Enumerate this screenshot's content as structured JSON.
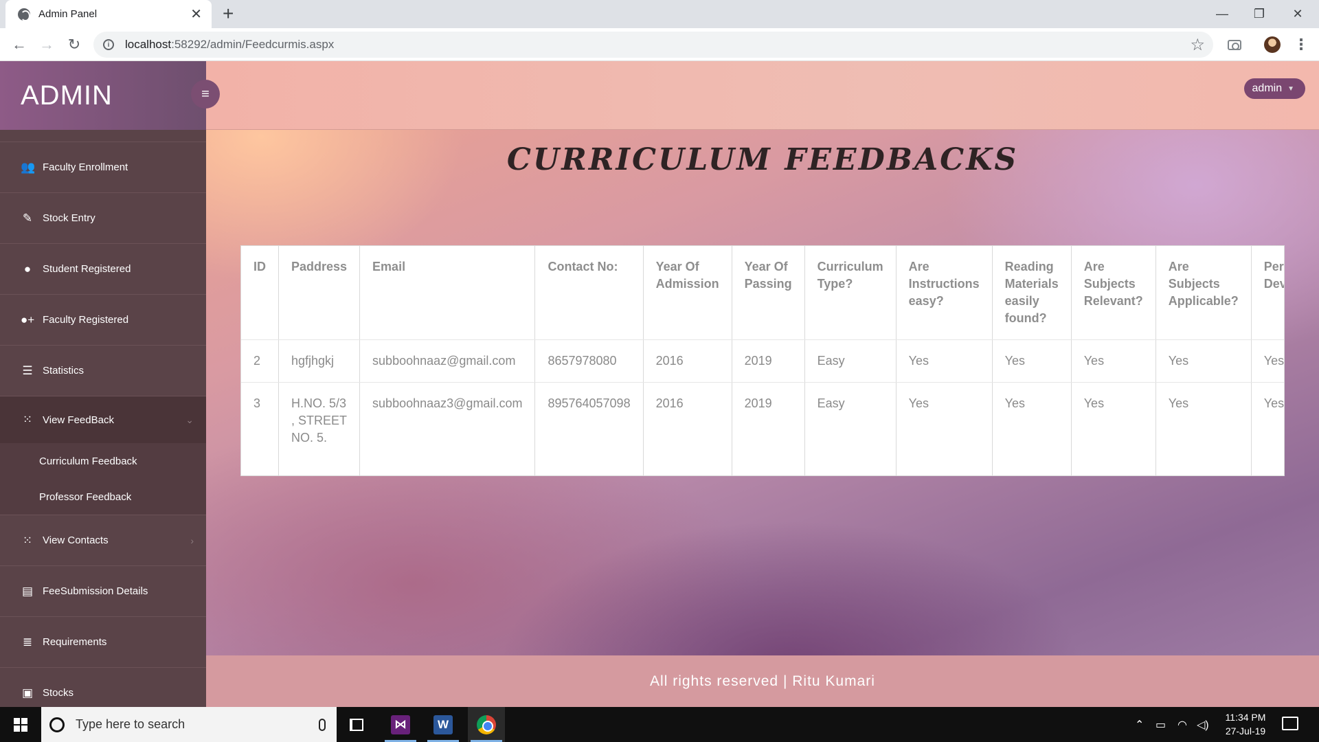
{
  "browser": {
    "tab_title": "Admin Panel",
    "tab_close": "✕",
    "new_tab": "+",
    "url_host": "localhost",
    "url_path": ":58292/admin/Feedcurmis.aspx",
    "window_controls": {
      "minimize": "—",
      "maximize": "❐",
      "close": "✕"
    }
  },
  "sidebar": {
    "brand": "ADMIN",
    "items": [
      {
        "label": "Faculty Enrollment",
        "icon": "users-icon"
      },
      {
        "label": "Stock Entry",
        "icon": "edit-icon"
      },
      {
        "label": "Student Registered",
        "icon": "user-icon"
      },
      {
        "label": "Faculty Registered",
        "icon": "user-plus-icon"
      },
      {
        "label": "Statistics",
        "icon": "list-icon"
      },
      {
        "label": "View FeedBack",
        "icon": "grid-icon",
        "expanded": true
      },
      {
        "label": "View Contacts",
        "icon": "grid-icon"
      },
      {
        "label": "FeeSubmission Details",
        "icon": "book-icon"
      },
      {
        "label": "Requirements",
        "icon": "tasks-icon"
      },
      {
        "label": "Stocks",
        "icon": "briefcase-icon"
      }
    ],
    "feedback_submenu": [
      "Curriculum Feedback",
      "Professor Feedback"
    ]
  },
  "header": {
    "user_button": "admin"
  },
  "main": {
    "title": "CURRICULUM FEEDBACKS",
    "table": {
      "columns": [
        "ID",
        "Paddress",
        "Email",
        "Contact No:",
        "Year Of Admission",
        "Year Of Passing",
        "Curriculum Type?",
        "Are Instructions easy?",
        "Reading Materials easily found?",
        "Are Subjects Relevant?",
        "Are Subjects Applicable?",
        "Personality Development?"
      ],
      "rows": [
        [
          "2",
          "hgfjhgkj",
          "subboohnaaz@gmail.com",
          "8657978080",
          "2016",
          "2019",
          "Easy",
          "Yes",
          "Yes",
          "Yes",
          "Yes",
          "Yes"
        ],
        [
          "3",
          "H.NO. 5/3 , STREET NO. 5.",
          "subboohnaaz3@gmail.com",
          "895764057098",
          "2016",
          "2019",
          "Easy",
          "Yes",
          "Yes",
          "Yes",
          "Yes",
          "Yes"
        ]
      ]
    }
  },
  "footer": {
    "text": "All rights reserved | Ritu Kumari"
  },
  "taskbar": {
    "search_placeholder": "Type here to search",
    "time": "11:34 PM",
    "date": "27-Jul-19"
  },
  "colors": {
    "sidebar_bg": "#5a4348",
    "brand_bg": "#8e5b87",
    "accent_button": "#7a4670",
    "footer_bg": "#d59a9f"
  }
}
